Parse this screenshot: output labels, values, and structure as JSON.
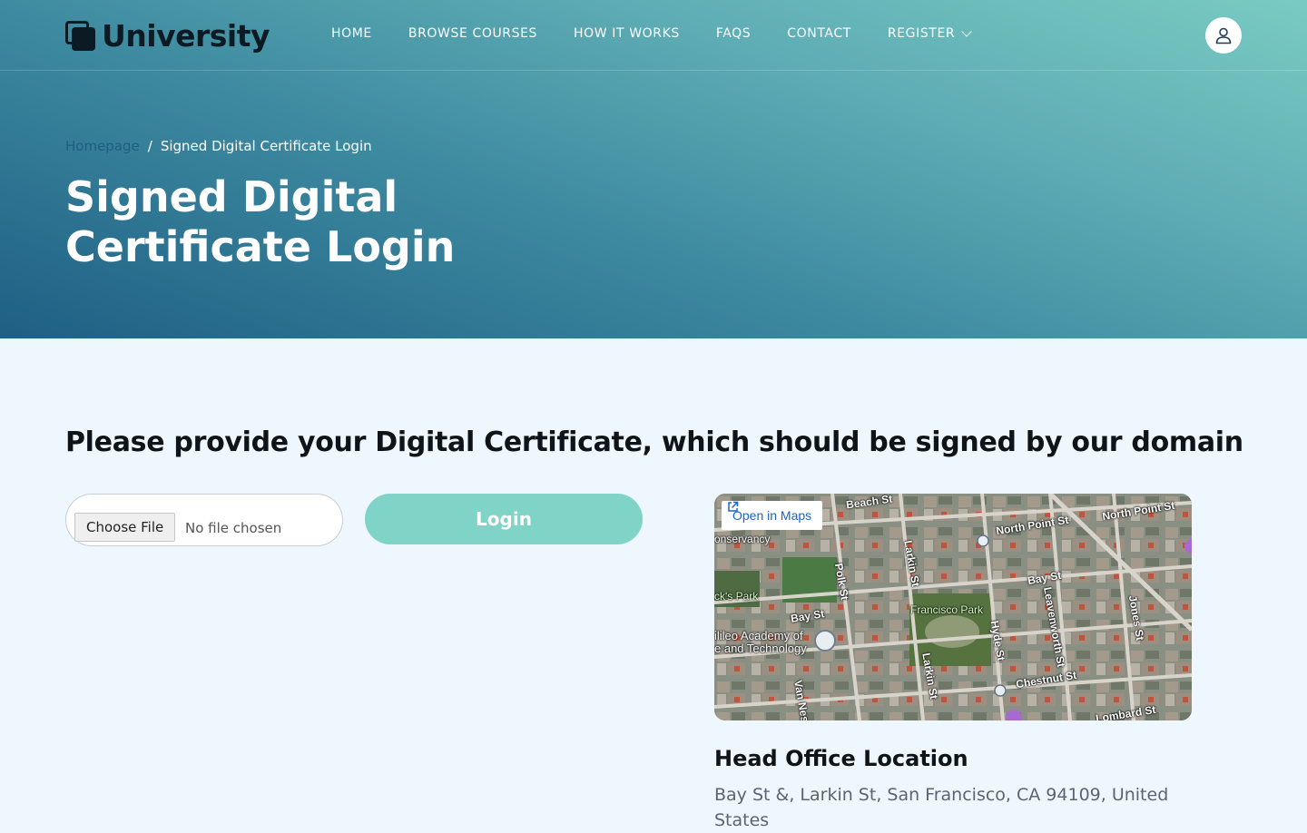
{
  "header": {
    "brand": "University",
    "nav": [
      {
        "label": "HOME"
      },
      {
        "label": "BROWSE COURSES"
      },
      {
        "label": "HOW IT WORKS"
      },
      {
        "label": "FAQS"
      },
      {
        "label": "CONTACT"
      },
      {
        "label": "REGISTER",
        "has_dropdown": true
      }
    ],
    "account_icon": "user-icon"
  },
  "breadcrumb": {
    "home": "Homepage",
    "separator": "/",
    "current": "Signed Digital Certificate Login"
  },
  "hero": {
    "title": "Signed Digital Certificate Login"
  },
  "form": {
    "prompt": "Please provide your Digital Certificate, which should be signed by our domain",
    "file_button": "Choose File",
    "file_status": "No file chosen",
    "submit_label": "Login"
  },
  "map": {
    "open_label": "Open in Maps",
    "street_labels": [
      "Beach St",
      "North Point St",
      "North Point St",
      "Bay St",
      "Bay St",
      "Polk St",
      "Larkin St",
      "Larkin St",
      "Hyde St",
      "Leavenworth St",
      "Jones St",
      "Chestnut St",
      "Lombard St",
      "Van Ness",
      "Francisco Park",
      "onservancy",
      "ck's Park",
      "ilileo Academy of",
      "e and Technology"
    ]
  },
  "office": {
    "title": "Head Office Location",
    "address": "Bay St &, Larkin St, San Francisco, CA 94109, United States"
  },
  "colors": {
    "hero_gradient_start": "#1f5f84",
    "hero_gradient_end": "#79cbc2",
    "page_background": "#eef6fe",
    "login_button": "#7fd3c7",
    "link": "#1f5f84"
  }
}
